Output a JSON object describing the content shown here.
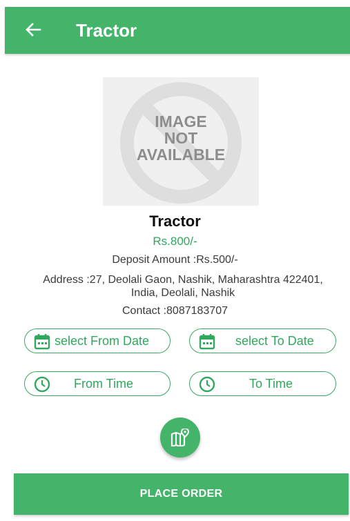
{
  "appbar": {
    "title": "Tractor",
    "back_icon": "arrow-left-icon",
    "color": "#43b46a"
  },
  "image_placeholder": {
    "line1": "IMAGE",
    "line2": "NOT",
    "line3": "AVAILABLE"
  },
  "product": {
    "name": "Tractor",
    "price": "Rs.800/-",
    "deposit": "Deposit Amount :Rs.500/-",
    "address_line1": "Address :27, Deolali Gaon, Nashik, Maharashtra 422401,",
    "address_line2": "India, Deolali, Nashik",
    "contact": "Contact :8087183707"
  },
  "date_buttons": {
    "from_label": "select From Date",
    "to_label": "select To Date",
    "icon": "calendar-icon"
  },
  "time_buttons": {
    "from_label": "From Time",
    "to_label": "To Time",
    "icon": "clock-icon"
  },
  "map_fab": {
    "icon": "map-pin-icon"
  },
  "order": {
    "label": "PLACE ORDER"
  },
  "colors": {
    "accent": "#43b46a",
    "accent_text": "#2fa85d"
  }
}
